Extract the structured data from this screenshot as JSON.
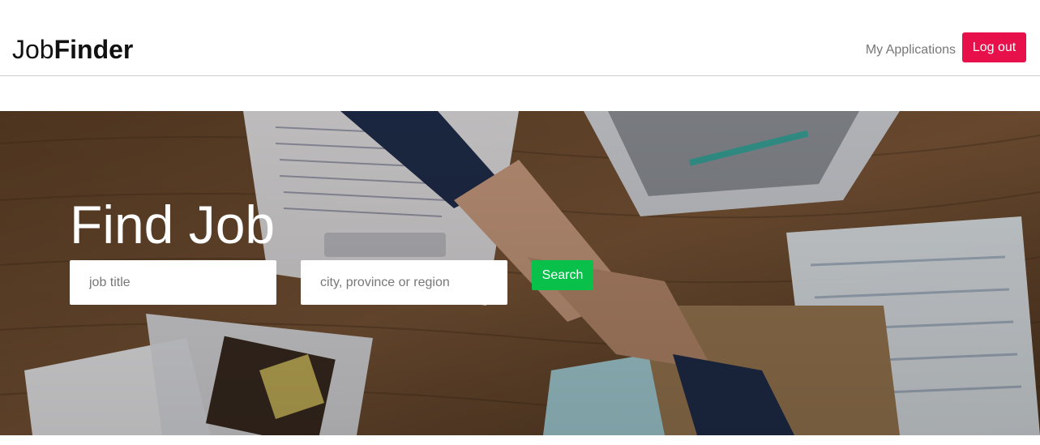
{
  "header": {
    "brand_part1": "Job",
    "brand_part2": "Finder",
    "nav_my_applications": "My Applications",
    "logout_label": "Log out"
  },
  "hero": {
    "title": "Find Job",
    "job_title_placeholder": "job title",
    "location_placeholder": "city, province or region",
    "search_label": "Search"
  },
  "colors": {
    "logout_button": "#e8104a",
    "search_button": "#08c04a",
    "nav_link": "#777777"
  }
}
